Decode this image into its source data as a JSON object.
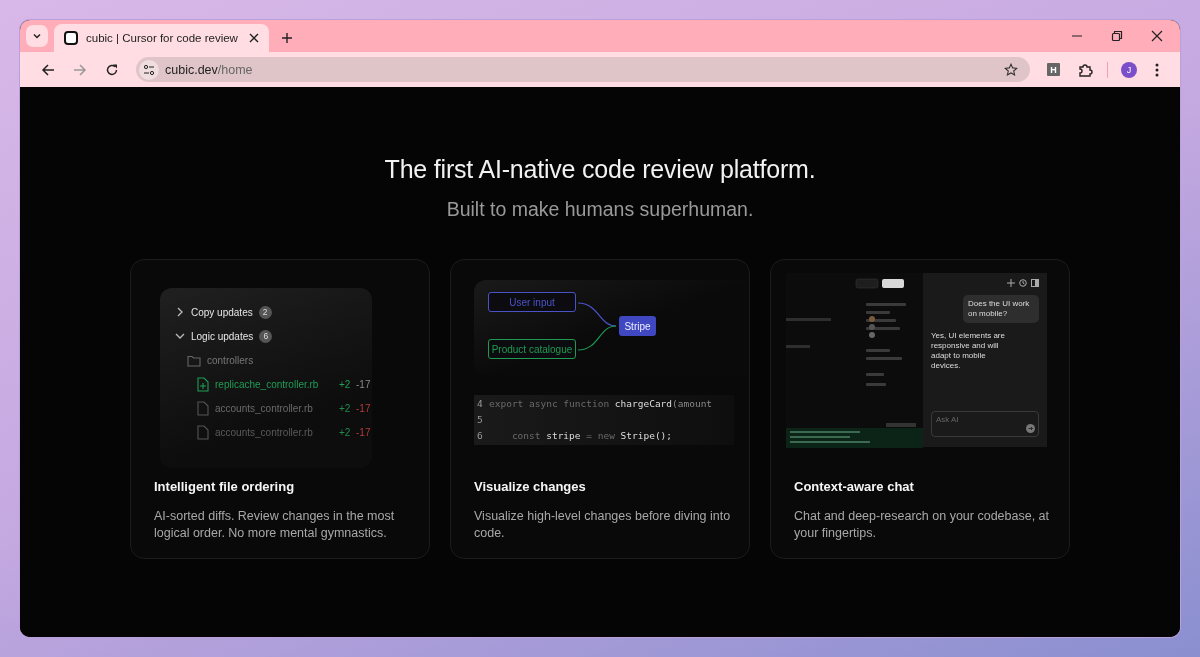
{
  "browser": {
    "tab_title": "cubic | Cursor for code review",
    "url_host": "cubic.dev",
    "url_path": "/home",
    "extension_label": "H",
    "profile_initial": "J"
  },
  "hero": {
    "title": "The first AI-native code review platform.",
    "subtitle": "Built to make humans superhuman."
  },
  "cards": [
    {
      "kind": "file-tree",
      "title": "Intelligent file ordering",
      "description": "AI-sorted diffs. Review changes in the most logical order. No more mental gymnastics.",
      "groups": [
        {
          "label": "Copy updates",
          "count": "2",
          "expanded": false
        },
        {
          "label": "Logic updates",
          "count": "6",
          "expanded": true,
          "children": [
            {
              "label": "controllers",
              "children": [
                {
                  "label": "replicache_controller.rb",
                  "added": "+2",
                  "removed": "-17",
                  "selected": true
                },
                {
                  "label": "accounts_controller.rb",
                  "added": "+2",
                  "removed": "-17",
                  "selected": false
                },
                {
                  "label": "accounts_controller.rb",
                  "added": "+2",
                  "removed": "-17",
                  "selected": false
                }
              ]
            }
          ]
        }
      ]
    },
    {
      "kind": "diagram",
      "title": "Visualize changes",
      "description": "Visualize high-level changes before diving into code.",
      "sources": [
        {
          "label": "User input",
          "color": "#4a52c8"
        },
        {
          "label": "Product catalogue",
          "color": "#1e9a53"
        }
      ],
      "target": {
        "label": "Stripe"
      },
      "code_lines": [
        {
          "number": "4",
          "tokens": [
            {
              "text": "export async function ",
              "kind": "keyword"
            },
            {
              "text": "chargeCard",
              "kind": "name"
            },
            {
              "text": "(amount",
              "kind": "plain"
            }
          ]
        },
        {
          "number": "5"
        },
        {
          "number": "6",
          "tokens": [
            {
              "text": "    const ",
              "kind": "keyword"
            },
            {
              "text": "stripe",
              "kind": "name"
            },
            {
              "text": " = new ",
              "kind": "keyword"
            },
            {
              "text": "Stripe();",
              "kind": "name"
            }
          ]
        }
      ]
    },
    {
      "kind": "chat",
      "title": "Context-aware chat",
      "description": "Chat and deep-research on your codebase, at your fingertips.",
      "messages": [
        {
          "kind": "question",
          "text": "Does the UI work on mobile?"
        },
        {
          "kind": "answer",
          "text": "Yes, UI elements are responsive and will adapt to mobile devices."
        }
      ],
      "input": {
        "placeholder": "Ask AI"
      }
    }
  ]
}
